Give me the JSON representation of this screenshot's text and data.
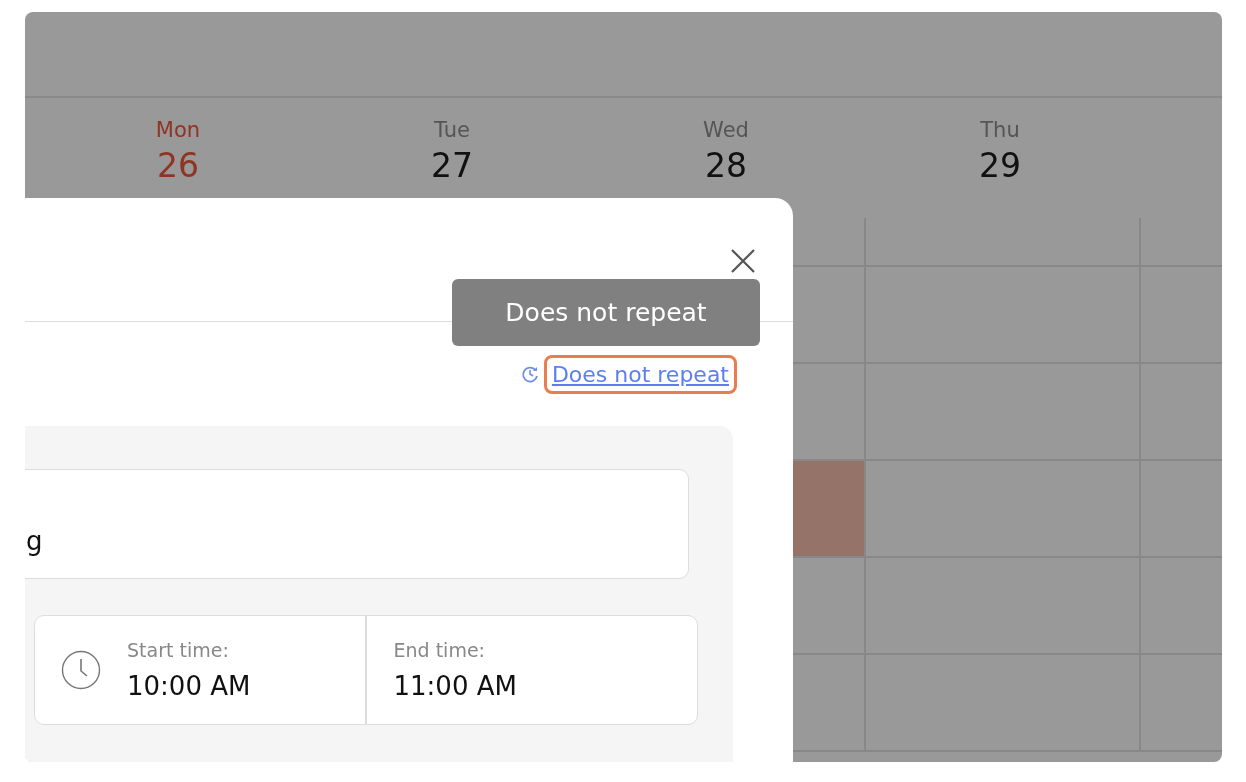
{
  "calendar": {
    "days": [
      {
        "name": "Mon",
        "date": "26",
        "today": true
      },
      {
        "name": "Tue",
        "date": "27",
        "today": false
      },
      {
        "name": "Wed",
        "date": "28",
        "today": false
      },
      {
        "name": "Thu",
        "date": "29",
        "today": false
      }
    ]
  },
  "dialog": {
    "tooltip": "Does not repeat",
    "repeat_link": "Does not repeat",
    "title_field": {
      "value": "g"
    },
    "start": {
      "label": "Start time:",
      "value": "10:00 AM"
    },
    "end": {
      "label": "End time:",
      "value": "11:00 AM"
    }
  }
}
